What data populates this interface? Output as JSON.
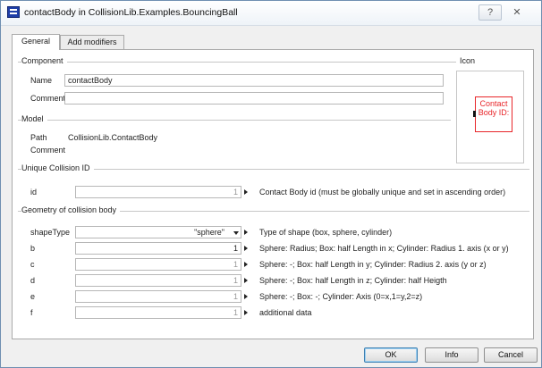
{
  "window": {
    "title": "contactBody in CollisionLib.Examples.BouncingBall",
    "help_glyph": "?",
    "close_glyph": "✕"
  },
  "tabs": [
    {
      "label": "General",
      "active": true
    },
    {
      "label": "Add modifiers",
      "active": false
    }
  ],
  "component": {
    "group_title": "Component",
    "name_label": "Name",
    "name_value": "contactBody",
    "comment_label": "Comment",
    "comment_value": ""
  },
  "icon_group": {
    "title": "Icon",
    "preview_text": "Contact Body ID:",
    "preview_color": "#e8262a"
  },
  "model": {
    "group_title": "Model",
    "path_label": "Path",
    "path_value": "CollisionLib.ContactBody",
    "comment_label": "Comment",
    "comment_value": ""
  },
  "unique_id": {
    "group_title": "Unique Collision ID",
    "id_label": "id",
    "id_value": "1",
    "id_description": "Contact Body id (must be globally unique and set in ascending order)"
  },
  "geometry": {
    "group_title": "Geometry of collision body",
    "rows": [
      {
        "label": "shapeType",
        "value": "\"sphere\"",
        "description": "Type of shape (box, sphere, cylinder)"
      },
      {
        "label": "b",
        "value": "1",
        "description": "Sphere: Radius; Box: half Length in x; Cylinder: Radius 1. axis (x or y)"
      },
      {
        "label": "c",
        "value": "1",
        "description": "Sphere: -; Box: half Length in y; Cylinder: Radius 2. axis (y or z)"
      },
      {
        "label": "d",
        "value": "1",
        "description": "Sphere: -; Box: half Length in z; Cylinder: half Heigth"
      },
      {
        "label": "e",
        "value": "1",
        "description": "Sphere: -; Box: -; Cylinder: Axis (0=x,1=y,2=z)"
      },
      {
        "label": "f",
        "value": "1",
        "description": "additional data"
      }
    ]
  },
  "buttons": {
    "ok": "OK",
    "info": "Info",
    "cancel": "Cancel"
  },
  "colors": {
    "accent_border": "#3c7fb1",
    "title_icon": "#1e3ea8"
  }
}
